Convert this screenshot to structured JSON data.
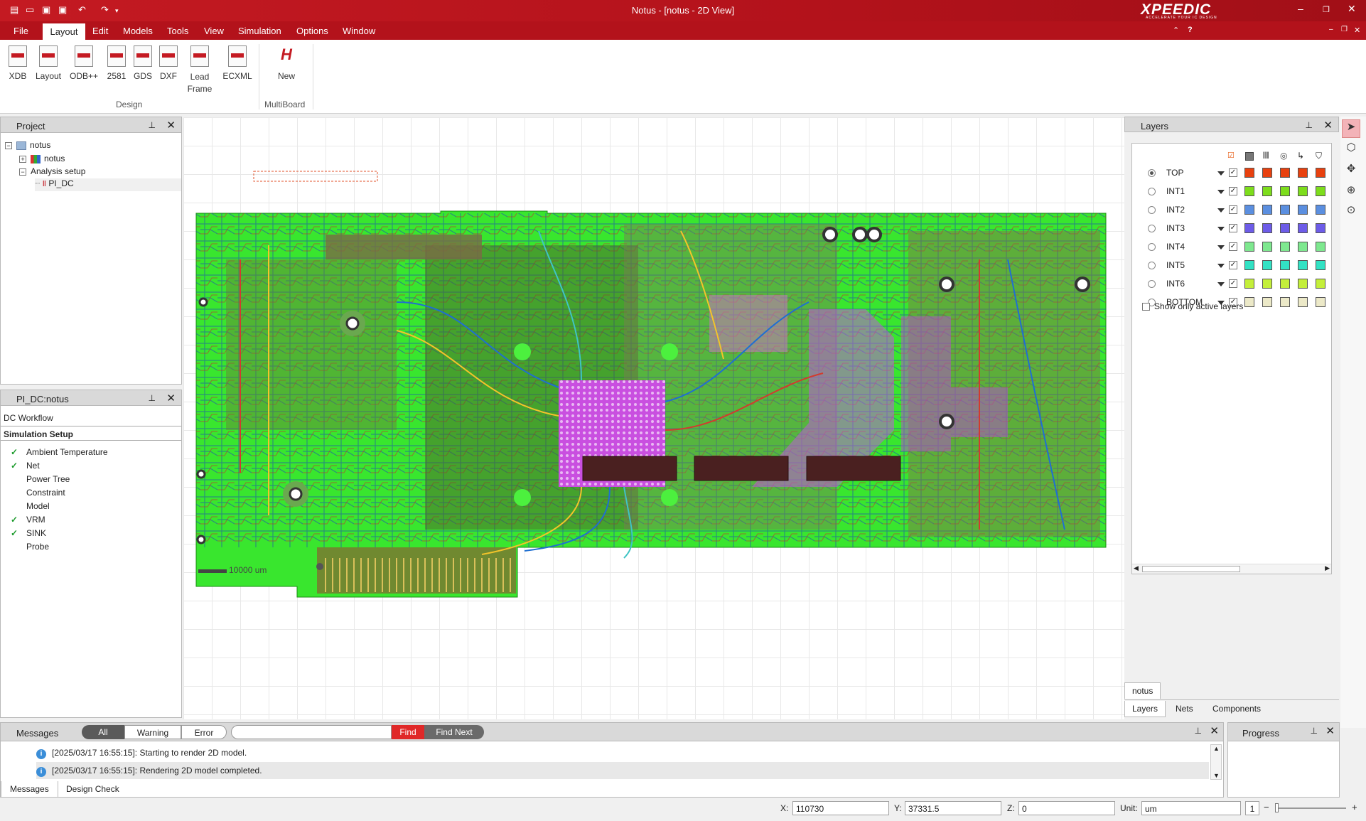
{
  "window": {
    "title": "Notus - [notus - 2D View]",
    "brand": "XPEEDIC",
    "brand_tagline": "ACCELERATE YOUR IC DESIGN"
  },
  "menu": {
    "items": [
      "File",
      "Layout",
      "Edit",
      "Models",
      "Tools",
      "View",
      "Simulation",
      "Options",
      "Window"
    ]
  },
  "ribbon": {
    "design_buttons": [
      {
        "label": "XDB",
        "icon": "xdb-file-icon"
      },
      {
        "label": "Layout",
        "icon": "layout-file-icon"
      },
      {
        "label": "ODB++",
        "icon": "odb-file-icon"
      },
      {
        "label": "2581",
        "icon": "ipc2581-file-icon"
      },
      {
        "label": "GDS",
        "icon": "gds-file-icon"
      },
      {
        "label": "DXF",
        "icon": "dxf-file-icon"
      },
      {
        "label": "Lead Frame",
        "icon": "lead-frame-file-icon"
      },
      {
        "label": "ECXML",
        "icon": "ecxml-file-icon"
      }
    ],
    "design_group_label": "Design",
    "multiboard_button": "New",
    "multiboard_group_label": "MultiBoard"
  },
  "project_panel": {
    "title": "Project",
    "tree": {
      "root": "notus",
      "child": "notus",
      "analysis": "Analysis setup",
      "setup": "PI_DC"
    }
  },
  "workflow_panel": {
    "title": "PI_DC:notus",
    "workflow_label": "DC Workflow",
    "section": "Simulation Setup",
    "steps": [
      {
        "label": "Ambient Temperature",
        "done": true
      },
      {
        "label": "Net",
        "done": true
      },
      {
        "label": "Power Tree",
        "done": false
      },
      {
        "label": "Constraint",
        "done": false
      },
      {
        "label": "Model",
        "done": false
      },
      {
        "label": "VRM",
        "done": true
      },
      {
        "label": "SINK",
        "done": true
      },
      {
        "label": "Probe",
        "done": false
      }
    ]
  },
  "canvas": {
    "scale_label": "10000 um"
  },
  "layers_panel": {
    "title": "Layers",
    "active_layer": "TOP",
    "layers": [
      {
        "name": "TOP",
        "color": "#e8410f"
      },
      {
        "name": "INT1",
        "color": "#7ddd1c"
      },
      {
        "name": "INT2",
        "color": "#5b8fe0"
      },
      {
        "name": "INT3",
        "color": "#6d5ce8"
      },
      {
        "name": "INT4",
        "color": "#7ee88f"
      },
      {
        "name": "INT5",
        "color": "#32e2c4"
      },
      {
        "name": "INT6",
        "color": "#c4ef3a"
      },
      {
        "name": "BOTTOM",
        "color": "#ece9c8"
      }
    ],
    "show_only_active": "Show only active layers",
    "design_tab": "notus",
    "tabs": [
      "Layers",
      "Nets",
      "Components"
    ]
  },
  "messages_panel": {
    "title": "Messages",
    "filters": [
      "All",
      "Warning",
      "Error"
    ],
    "search_value": "",
    "find_label": "Find",
    "find_next_label": "Find Next",
    "rows": [
      "[2025/03/17 16:55:15]: Starting to render 2D model.",
      "[2025/03/17 16:55:15]: Rendering 2D model completed."
    ],
    "tabs": [
      "Messages",
      "Design Check"
    ]
  },
  "progress_panel": {
    "title": "Progress"
  },
  "status": {
    "x_label": "X:",
    "x": "110730",
    "y_label": "Y:",
    "y": "37331.5",
    "z_label": "Z:",
    "z": "0",
    "unit_label": "Unit:",
    "unit": "um",
    "zoom": "1"
  }
}
